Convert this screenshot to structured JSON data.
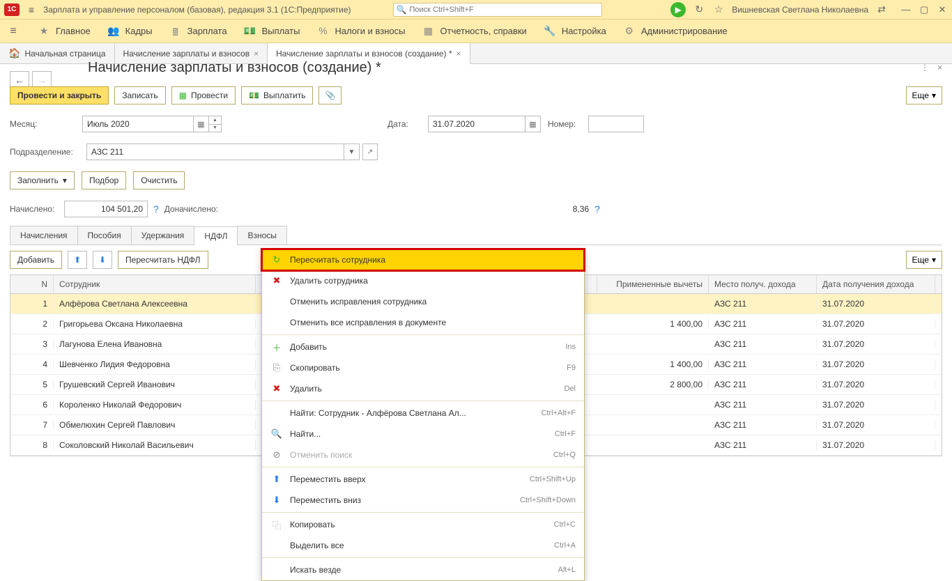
{
  "titlebar": {
    "app_title": "Зарплата и управление персоналом (базовая), редакция 3.1  (1С:Предприятие)",
    "search_placeholder": "Поиск Ctrl+Shift+F",
    "user": "Вишневская Светлана Николаевна"
  },
  "main_menu": [
    {
      "label": "Главное",
      "name": "main"
    },
    {
      "label": "Кадры",
      "name": "hr"
    },
    {
      "label": "Зарплата",
      "name": "salary"
    },
    {
      "label": "Выплаты",
      "name": "payments"
    },
    {
      "label": "Налоги и взносы",
      "name": "taxes"
    },
    {
      "label": "Отчетность, справки",
      "name": "reports"
    },
    {
      "label": "Настройка",
      "name": "settings"
    },
    {
      "label": "Администрирование",
      "name": "admin"
    }
  ],
  "page_tabs": [
    {
      "label": "Начальная страница",
      "name": "home",
      "closable": false
    },
    {
      "label": "Начисление зарплаты и взносов",
      "name": "calc-list",
      "closable": true
    },
    {
      "label": "Начисление зарплаты и взносов (создание) *",
      "name": "calc-create",
      "closable": true,
      "active": true
    }
  ],
  "page_title": "Начисление зарплаты и взносов (создание) *",
  "toolbar": {
    "post_close": "Провести и закрыть",
    "save": "Записать",
    "post": "Провести",
    "pay": "Выплатить",
    "more": "Еще"
  },
  "form": {
    "month_label": "Месяц:",
    "month_value": "Июль 2020",
    "date_label": "Дата:",
    "date_value": "31.07.2020",
    "number_label": "Номер:",
    "number_value": "",
    "dept_label": "Подразделение:",
    "dept_value": "АЗС 211"
  },
  "actions": {
    "fill": "Заполнить",
    "pick": "Подбор",
    "clear": "Очистить"
  },
  "totals": {
    "accrued_label": "Начислено:",
    "accrued_value": "104 501,20",
    "addl_label": "Доначислено:",
    "trailing_value": "8,36"
  },
  "inner_tabs": [
    {
      "label": "Начисления",
      "name": "accruals"
    },
    {
      "label": "Пособия",
      "name": "benefits"
    },
    {
      "label": "Удержания",
      "name": "deductions"
    },
    {
      "label": "НДФЛ",
      "name": "ndfl",
      "active": true
    },
    {
      "label": "Взносы",
      "name": "contrib"
    }
  ],
  "ndfl_toolbar": {
    "add": "Добавить",
    "recalc": "Пересчитать НДФЛ",
    "more": "Еще"
  },
  "grid": {
    "cols": {
      "n": "N",
      "employee": "Сотрудник",
      "deductions": "Примененные вычеты",
      "location": "Место получ. дохода",
      "date": "Дата получения дохода"
    },
    "rows": [
      {
        "n": "1",
        "employee": "Алфёрова Светлана Алексеевна",
        "ded": "",
        "loc": "АЗС 211",
        "date": "31.07.2020",
        "sel": true
      },
      {
        "n": "2",
        "employee": "Григорьева Оксана Николаевна",
        "ded": "1 400,00",
        "loc": "АЗС 211",
        "date": "31.07.2020"
      },
      {
        "n": "3",
        "employee": "Лагунова Елена Ивановна",
        "ded": "",
        "loc": "АЗС 211",
        "date": "31.07.2020"
      },
      {
        "n": "4",
        "employee": "Шевченко Лидия Федоровна",
        "ded": "1 400,00",
        "loc": "АЗС 211",
        "date": "31.07.2020"
      },
      {
        "n": "5",
        "employee": "Грушевский Сергей Иванович",
        "ded": "2 800,00",
        "loc": "АЗС 211",
        "date": "31.07.2020"
      },
      {
        "n": "6",
        "employee": "Короленко Николай Федорович",
        "ded": "",
        "loc": "АЗС 211",
        "date": "31.07.2020"
      },
      {
        "n": "7",
        "employee": "Обмелюхин Сергей Павлович",
        "ded": "",
        "loc": "АЗС 211",
        "date": "31.07.2020"
      },
      {
        "n": "8",
        "employee": "Соколовский Николай Васильевич",
        "ded": "",
        "loc": "АЗС 211",
        "date": "31.07.2020"
      }
    ]
  },
  "context_menu": {
    "recalc_emp": "Пересчитать сотрудника",
    "delete_emp": "Удалить сотрудника",
    "cancel_emp": "Отменить исправления сотрудника",
    "cancel_all": "Отменить все исправления в документе",
    "add": "Добавить",
    "add_hk": "Ins",
    "copy": "Скопировать",
    "copy_hk": "F9",
    "delete": "Удалить",
    "delete_hk": "Del",
    "find": "Найти: Сотрудник - Алфёрова Светлана Ал...",
    "find_hk": "Ctrl+Alt+F",
    "search": "Найти...",
    "search_hk": "Ctrl+F",
    "cancel_search": "Отменить поиск",
    "cancel_search_hk": "Ctrl+Q",
    "move_up": "Переместить вверх",
    "move_up_hk": "Ctrl+Shift+Up",
    "move_down": "Переместить вниз",
    "move_down_hk": "Ctrl+Shift+Down",
    "copy2": "Копировать",
    "copy2_hk": "Ctrl+C",
    "select_all": "Выделить все",
    "select_all_hk": "Ctrl+A",
    "search_everywhere": "Искать везде",
    "search_everywhere_hk": "Alt+L"
  }
}
